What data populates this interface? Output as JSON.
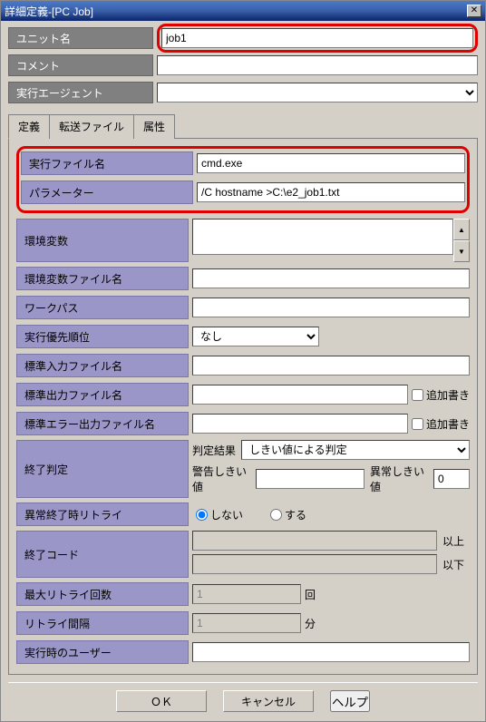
{
  "window": {
    "title": "詳細定義-[PC Job]"
  },
  "top": {
    "unitNameLabel": "ユニット名",
    "unitName": "job1",
    "commentLabel": "コメント",
    "comment": "",
    "agentLabel": "実行エージェント",
    "agent": ""
  },
  "tabs": {
    "defn": "定義",
    "transfer": "転送ファイル",
    "attr": "属性"
  },
  "defn": {
    "execFileLabel": "実行ファイル名",
    "execFile": "cmd.exe",
    "paramLabel": "パラメーター",
    "param": "/C hostname >C:\\e2_job1.txt",
    "envVarLabel": "環境変数",
    "envVar": "",
    "envVarFileLabel": "環境変数ファイル名",
    "envVarFile": "",
    "workPathLabel": "ワークパス",
    "workPath": "",
    "priorityLabel": "実行優先順位",
    "priority": "なし",
    "stdinFileLabel": "標準入力ファイル名",
    "stdinFile": "",
    "stdoutFileLabel": "標準出力ファイル名",
    "stdoutFile": "",
    "appendLabel": "追加書き",
    "stderrFileLabel": "標準エラー出力ファイル名",
    "stderrFile": "",
    "endJudgeLabel": "終了判定",
    "judgeResultLabel": "判定結果",
    "judgeResult": "しきい値による判定",
    "warnThreshLabel": "警告しきい値",
    "warnThresh": "",
    "abnThreshLabel": "異常しきい値",
    "abnThresh": "0",
    "retryOnFailLabel": "異常終了時リトライ",
    "retryNo": "しない",
    "retryYes": "する",
    "exitCodeLabel": "終了コード",
    "exitCodeFrom": "",
    "above": "以上",
    "exitCodeTo": "",
    "below": "以下",
    "maxRetryLabel": "最大リトライ回数",
    "maxRetry": "1",
    "timesUnit": "回",
    "retryIntervalLabel": "リトライ間隔",
    "retryInterval": "1",
    "minUnit": "分",
    "execUserLabel": "実行時のユーザー",
    "execUser": ""
  },
  "buttons": {
    "ok": "ＯＫ",
    "cancel": "キャンセル",
    "help": "ヘルプ"
  }
}
